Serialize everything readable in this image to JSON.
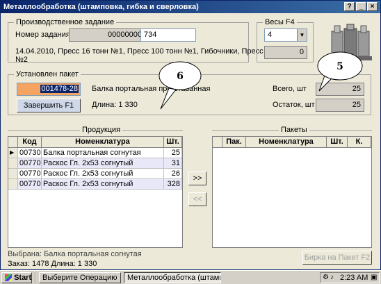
{
  "window": {
    "title": "Металлообработка (штамповка, гибка и сверловка)"
  },
  "production_task": {
    "group_label": "Производственное задание",
    "task_number_label": "Номер задания",
    "task_number_value": "00000000",
    "task_number_value2": "734",
    "description_line1": "14.04.2010, Пресс 16 тонн №1, Пресс 100 тонн №1, Гибочники, Пресс 16 тонн",
    "description_line2": "№2"
  },
  "scales": {
    "group_label": "Весы  F4",
    "select_value": "4",
    "weight_value": "0"
  },
  "package": {
    "group_label": "Установлен пакет",
    "code_prefix": "",
    "code_value": "001478-28",
    "name": "Балка портальная прошта",
    "name_tail": "ванная",
    "length": "Длина: 1 330",
    "finish_button": "Завершить      F1",
    "total_label": "Всего, шт",
    "total_value": "25",
    "remaining_label": "Остаток, шт",
    "remaining_value": "25"
  },
  "products": {
    "section_label": "Продукция",
    "columns": [
      "Код",
      "Номенклатура",
      "Шт."
    ],
    "rows": [
      {
        "code": "00730",
        "name": "Балка портальная согнутая",
        "qty": "25"
      },
      {
        "code": "00770",
        "name": "Раскос Гл. 2х53 согнутый",
        "qty": "31"
      },
      {
        "code": "00770",
        "name": "Раскос Гл. 2х53 согнутый",
        "qty": "26"
      },
      {
        "code": "00770",
        "name": "Раскос Гл. 2х53 согнутый",
        "qty": "328"
      }
    ]
  },
  "transfer": {
    "add": ">>",
    "remove": "<<"
  },
  "packages": {
    "section_label": "Пакеты",
    "columns": [
      "Пак.",
      "Номенклатура",
      "Шт.",
      "К."
    ]
  },
  "footer": {
    "selected": "Выбрана: Балка портальная согнутая",
    "order": "Заказ: 1478  Длина: 1 330",
    "tag_button": "Бирка на Пакет  F2"
  },
  "callouts": {
    "c6": "6",
    "c5": "5"
  },
  "taskbar": {
    "start": "Start",
    "task1": "Выберите Операцию",
    "task2": "Металлообработка (штамповка, ...",
    "clock": "2:23 AM"
  },
  "colors": {
    "title_bar": "#0a246a",
    "highlight_field": "#f4a460",
    "selection": "#0a246a",
    "window_bg": "#ece9d8"
  }
}
